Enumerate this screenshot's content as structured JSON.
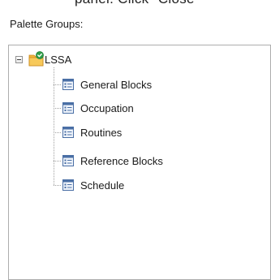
{
  "header": {
    "cut_off_text": "panel. Click \"Close\""
  },
  "palette_groups": {
    "label": "Palette Groups:",
    "root": {
      "label": "LSSA",
      "icon": "palette-group-folder-icon",
      "expanded": true,
      "children": [
        {
          "label": "General Blocks",
          "icon": "block-list-icon"
        },
        {
          "label": "Occupation",
          "icon": "block-list-icon"
        },
        {
          "label": "Routines",
          "icon": "block-list-icon"
        },
        {
          "label": "Reference Blocks",
          "icon": "block-list-icon"
        },
        {
          "label": "Schedule",
          "icon": "block-list-icon"
        }
      ]
    }
  },
  "colors": {
    "folder": "#f2b43c",
    "badge": "#2e9e49",
    "tree_line": "#a0a0a0",
    "panel_border": "#adadad"
  }
}
